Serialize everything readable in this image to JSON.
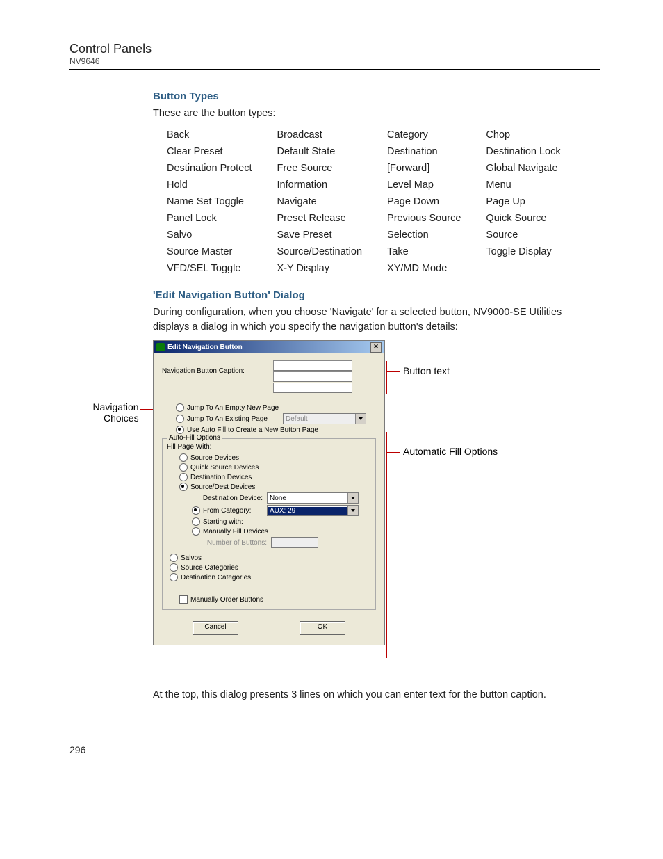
{
  "header": {
    "title": "Control Panels",
    "subtitle": "NV9646"
  },
  "s1": {
    "title": "Button Types",
    "intro": "These are the button types:",
    "rows": [
      {
        "c0": "Back",
        "c1": "Broadcast",
        "c2": "Category",
        "c3": "Chop"
      },
      {
        "c0": "Clear Preset",
        "c1": "Default State",
        "c2": "Destination",
        "c3": "Destination Lock"
      },
      {
        "c0": "Destination Protect",
        "c1": "Free Source",
        "c2": "[Forward]",
        "c3": "Global Navigate"
      },
      {
        "c0": "Hold",
        "c1": "Information",
        "c2": "Level Map",
        "c3": "Menu"
      },
      {
        "c0": "Name Set Toggle",
        "c1": "Navigate",
        "c2": "Page Down",
        "c3": "Page Up"
      },
      {
        "c0": "Panel Lock",
        "c1": "Preset Release",
        "c2": "Previous Source",
        "c3": "Quick Source"
      },
      {
        "c0": "Salvo",
        "c1": "Save Preset",
        "c2": "Selection",
        "c3": "Source"
      },
      {
        "c0": "Source Master",
        "c1": "Source/Destination",
        "c2": "Take",
        "c3": "Toggle Display"
      },
      {
        "c0": "VFD/SEL Toggle",
        "c1": "X-Y Display",
        "c2": "XY/MD Mode",
        "c3": ""
      }
    ]
  },
  "s2": {
    "title": "'Edit Navigation Button' Dialog",
    "intro": "During configuration, when you choose 'Navigate' for a selected button, NV9000-SE Utilities displays a dialog in which you specify the navigation button's details:",
    "after": "At the top, this dialog presents 3 lines on which you can enter text for the button caption."
  },
  "dialog": {
    "title": "Edit Navigation Button",
    "caption_label": "Navigation Button Caption:",
    "nav": {
      "r0": "Jump To An Empty New Page",
      "r1": "Jump To An Existing Page",
      "r1_combo": "Default",
      "r2": "Use Auto Fill to Create a New Button Page"
    },
    "group_title": "Auto-Fill Options",
    "fill_label": "Fill Page With:",
    "fill": {
      "r0": "Source Devices",
      "r1": "Quick Source Devices",
      "r2": "Destination Devices",
      "r3": "Source/Dest Devices",
      "dest_label": "Destination Device:",
      "dest_combo": "None",
      "r4": "From Category:",
      "cat_combo": "AUX: 29",
      "r5": "Starting with:",
      "r6": "Manually Fill Devices",
      "num_label": "Number of Buttons:"
    },
    "extra": {
      "r0": "Salvos",
      "r1": "Source Categories",
      "r2": "Destination Categories"
    },
    "chk": "Manually Order Buttons",
    "cancel": "Cancel",
    "ok": "OK"
  },
  "annotations": {
    "nav_choices": "Navigation",
    "nav_choices2": "Choices",
    "button_text": "Button text",
    "auto_fill": "Automatic Fill Options"
  },
  "page_num": "296"
}
